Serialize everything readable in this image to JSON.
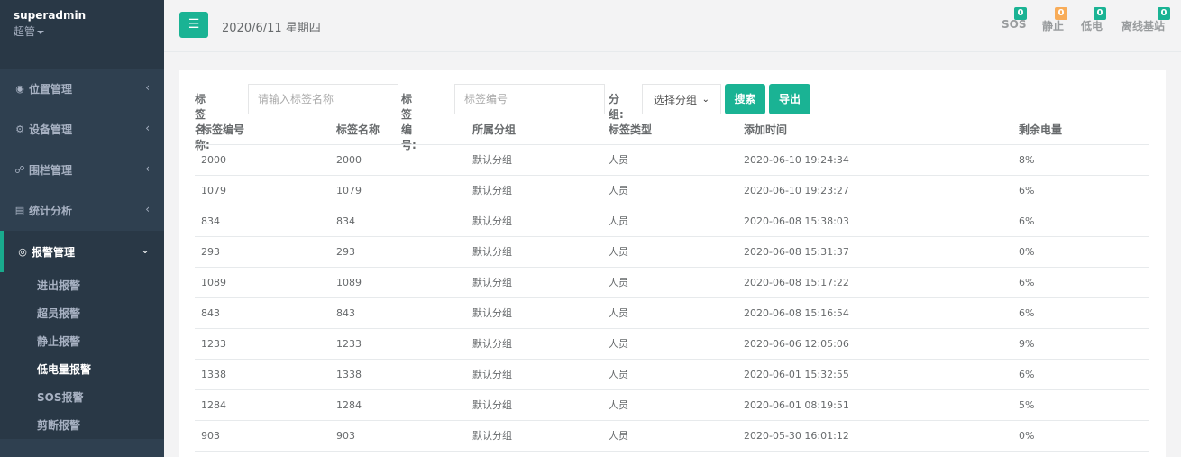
{
  "profile": {
    "username": "superadmin",
    "role": "超管"
  },
  "nav": {
    "items": [
      {
        "label": "位置管理",
        "icon": "map-marker-icon"
      },
      {
        "label": "设备管理",
        "icon": "cogs-icon"
      },
      {
        "label": "围栏管理",
        "icon": "link-icon"
      },
      {
        "label": "统计分析",
        "icon": "bar-chart-icon"
      },
      {
        "label": "报警管理",
        "icon": "eye-icon"
      }
    ],
    "sub_items": [
      "进出报警",
      "超员报警",
      "静止报警",
      "低电量报警",
      "SOS报警",
      "剪断报警"
    ],
    "current_sub": "低电量报警"
  },
  "topbar": {
    "date": "2020/6/11 星期四",
    "status": [
      {
        "label": "SOS",
        "count": "0",
        "color": "#1ab394"
      },
      {
        "label": "静止",
        "count": "0",
        "color": "#f8ac59"
      },
      {
        "label": "低电",
        "count": "0",
        "color": "#1ab394"
      },
      {
        "label": "离线基站",
        "count": "0",
        "color": "#1ab394"
      }
    ]
  },
  "filters": {
    "name_label": "标签名称:",
    "name_placeholder": "请输入标签名称",
    "code_label": "标签编号:",
    "code_placeholder": "标签编号",
    "group_label": "分组:",
    "group_value": "选择分组",
    "search_label": "搜索",
    "export_label": "导出"
  },
  "table": {
    "headers": [
      "标签编号",
      "标签名称",
      "所属分组",
      "标签类型",
      "添加时间",
      "剩余电量"
    ],
    "rows": [
      [
        "2000",
        "2000",
        "默认分组",
        "人员",
        "2020-06-10 19:24:34",
        "8%"
      ],
      [
        "1079",
        "1079",
        "默认分组",
        "人员",
        "2020-06-10 19:23:27",
        "6%"
      ],
      [
        "834",
        "834",
        "默认分组",
        "人员",
        "2020-06-08 15:38:03",
        "6%"
      ],
      [
        "293",
        "293",
        "默认分组",
        "人员",
        "2020-06-08 15:31:37",
        "0%"
      ],
      [
        "1089",
        "1089",
        "默认分组",
        "人员",
        "2020-06-08 15:17:22",
        "6%"
      ],
      [
        "843",
        "843",
        "默认分组",
        "人员",
        "2020-06-08 15:16:54",
        "6%"
      ],
      [
        "1233",
        "1233",
        "默认分组",
        "人员",
        "2020-06-06 12:05:06",
        "9%"
      ],
      [
        "1338",
        "1338",
        "默认分组",
        "人员",
        "2020-06-01 15:32:55",
        "6%"
      ],
      [
        "1284",
        "1284",
        "默认分组",
        "人员",
        "2020-06-01 08:19:51",
        "5%"
      ],
      [
        "903",
        "903",
        "默认分组",
        "人员",
        "2020-05-30 16:01:12",
        "0%"
      ]
    ]
  },
  "colors": {
    "accent": "#1ab394",
    "sidebar": "#2f4050",
    "warning": "#f8ac59"
  }
}
